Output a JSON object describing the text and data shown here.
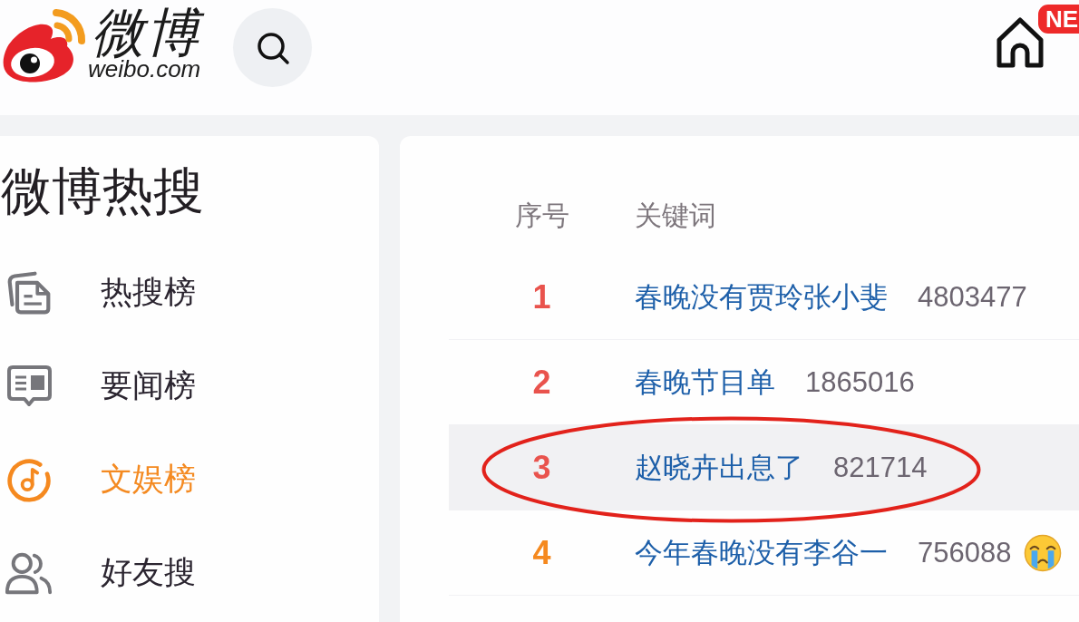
{
  "header": {
    "logo": {
      "wordmark": "微博",
      "domain": "weibo.com"
    },
    "home_badge": "NE"
  },
  "sidebar": {
    "title": "微博热搜",
    "items": [
      {
        "kind": "hot",
        "label": "热搜榜",
        "selected": false
      },
      {
        "kind": "news",
        "label": "要闻榜",
        "selected": false
      },
      {
        "kind": "entertainment",
        "label": "文娱榜",
        "selected": true
      },
      {
        "kind": "friends",
        "label": "好友搜",
        "selected": false
      }
    ]
  },
  "table": {
    "columns": [
      "序号",
      "关键词"
    ],
    "rows": [
      {
        "rank": "1",
        "color": "#e9534d",
        "keyword": "春晚没有贾玲张小斐",
        "count": "4803477",
        "selected": false,
        "circled": false,
        "emoji": false
      },
      {
        "rank": "2",
        "color": "#e9534d",
        "keyword": "春晚节目单",
        "count": "1865016",
        "selected": false,
        "circled": false,
        "emoji": false
      },
      {
        "rank": "3",
        "color": "#e9534d",
        "keyword": "赵晓卉出息了",
        "count": "821714",
        "selected": true,
        "circled": true,
        "emoji": false
      },
      {
        "rank": "4",
        "color": "#f5891f",
        "keyword": "今年春晚没有李谷一",
        "count": "756088",
        "selected": false,
        "circled": false,
        "emoji": true
      }
    ]
  }
}
